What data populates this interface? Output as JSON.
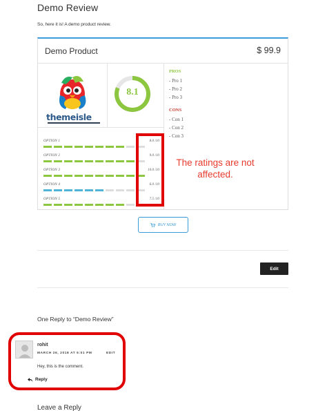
{
  "post": {
    "title": "Demo Review",
    "intro": "So, here it is! A demo product review."
  },
  "review": {
    "product_name": "Demo Product",
    "price": "$ 99.9",
    "brand_text": "themeisle",
    "score": "8.1",
    "score_fraction": 0.81,
    "pros_title": "PROS",
    "pros": [
      "- Pro 1",
      "- Pro 2",
      "- Pro 3"
    ],
    "cons_title": "CONS",
    "cons": [
      "- Con 1",
      "- Con 2",
      "- Con 3"
    ],
    "options": [
      {
        "label": "OPTION 1",
        "score": "8.0 /10",
        "value": 8.0,
        "color": "#8dc63f"
      },
      {
        "label": "OPTION 2",
        "score": "9.0 /10",
        "value": 9.0,
        "color": "#8dc63f"
      },
      {
        "label": "OPTION 3",
        "score": "10.0 /10",
        "value": 10.0,
        "color": "#8dc63f"
      },
      {
        "label": "OPTION 4",
        "score": "6.0 /10",
        "value": 6.0,
        "color": "#50b4d8"
      },
      {
        "label": "OPTION 5",
        "score": "7.5 /10",
        "value": 7.5,
        "color": "#8dc63f"
      }
    ],
    "buy_label": "BUY NOW",
    "colors": {
      "accent": "#3a9bd9",
      "score_green": "#8dc63f",
      "pros": "#8dc63f",
      "cons": "#c0392b",
      "bar_empty": "#dddddd"
    }
  },
  "annotations": {
    "ratings_note": "The ratings are not affected.",
    "color": "#e00000"
  },
  "actions": {
    "edit_label": "Edit"
  },
  "comments": {
    "title": "One Reply to “Demo Review”",
    "items": [
      {
        "author": "rohit",
        "date": "MARCH 26, 2018 AT 5:01 PM",
        "edit": "EDIT",
        "text": "Hey, this is the comment.",
        "reply_label": "Reply"
      }
    ]
  },
  "leave_reply": {
    "title": "Leave a Reply"
  }
}
